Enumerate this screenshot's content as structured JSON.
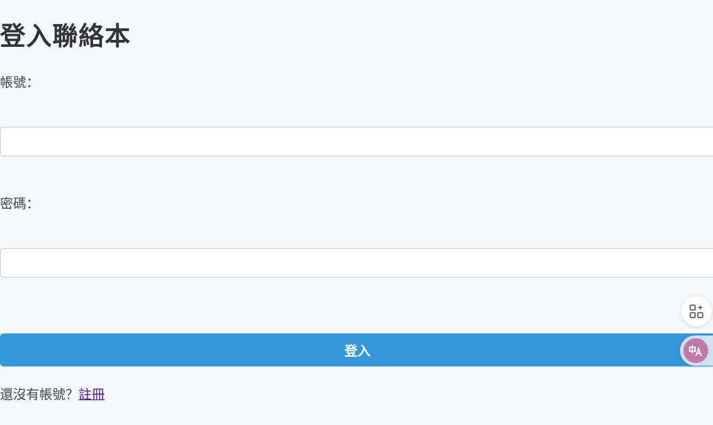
{
  "page": {
    "title": "登入聯絡本"
  },
  "form": {
    "username_label": "帳號：",
    "username_value": "",
    "password_label": "密碼：",
    "password_value": "",
    "login_button": "登入"
  },
  "footer": {
    "prompt": "還沒有帳號？",
    "register_link": "註冊"
  },
  "floating": {
    "widget_icon": "apps-sparkle-icon",
    "translate_icon": "translate-icon"
  },
  "colors": {
    "background": "#f7f8fc",
    "button": "#3498db",
    "link": "#551a8b",
    "translate_badge": "#c17aa6"
  }
}
